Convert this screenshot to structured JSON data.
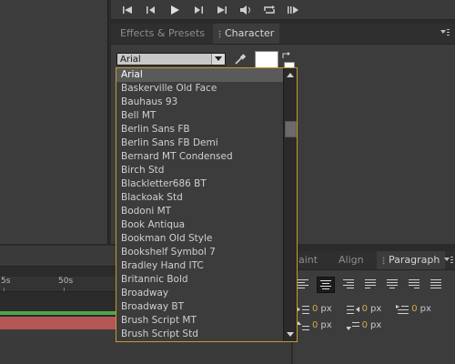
{
  "preview": {
    "buttons": [
      "first-frame",
      "previous-frame",
      "play",
      "next-frame",
      "last-frame",
      "audio",
      "loop",
      "ram-preview"
    ]
  },
  "character_panel": {
    "tabs": [
      {
        "label": "Effects & Presets"
      },
      {
        "label": "Character"
      }
    ],
    "font_value": "Arial",
    "fill_color": "#ffffff",
    "stroke_color": "#ffffff"
  },
  "font_list": {
    "items": [
      "Arial",
      "Baskerville Old Face",
      "Bauhaus 93",
      "Bell MT",
      "Berlin Sans FB",
      "Berlin Sans FB Demi",
      "Bernard MT Condensed",
      "Birch Std",
      "Blackletter686 BT",
      "Blackoak Std",
      "Bodoni MT",
      "Book Antiqua",
      "Bookman Old Style",
      "Bookshelf Symbol 7",
      "Bradley Hand ITC",
      "Britannic Bold",
      "Broadway",
      "Broadway BT",
      "Brush Script MT",
      "Brush Script Std"
    ],
    "selected_index": 0
  },
  "timeline": {
    "ruler_labels": [
      "5s",
      "50s"
    ]
  },
  "paragraph_panel": {
    "tabs": [
      {
        "label": "aint"
      },
      {
        "label": "Align"
      },
      {
        "label": "Paragraph"
      }
    ],
    "indent_left": {
      "value": "0",
      "unit": "px"
    },
    "indent_right": {
      "value": "0",
      "unit": "px"
    },
    "indent_first": {
      "value": "0",
      "unit": "px"
    },
    "space_before": {
      "value": "0",
      "unit": "px"
    },
    "space_after": {
      "value": "0",
      "unit": "px"
    }
  },
  "colors": {
    "accent_border": "#c99a2e",
    "value_text": "#d8a84a",
    "timeline_green": "#4aa84a",
    "timeline_red": "#b35656"
  }
}
